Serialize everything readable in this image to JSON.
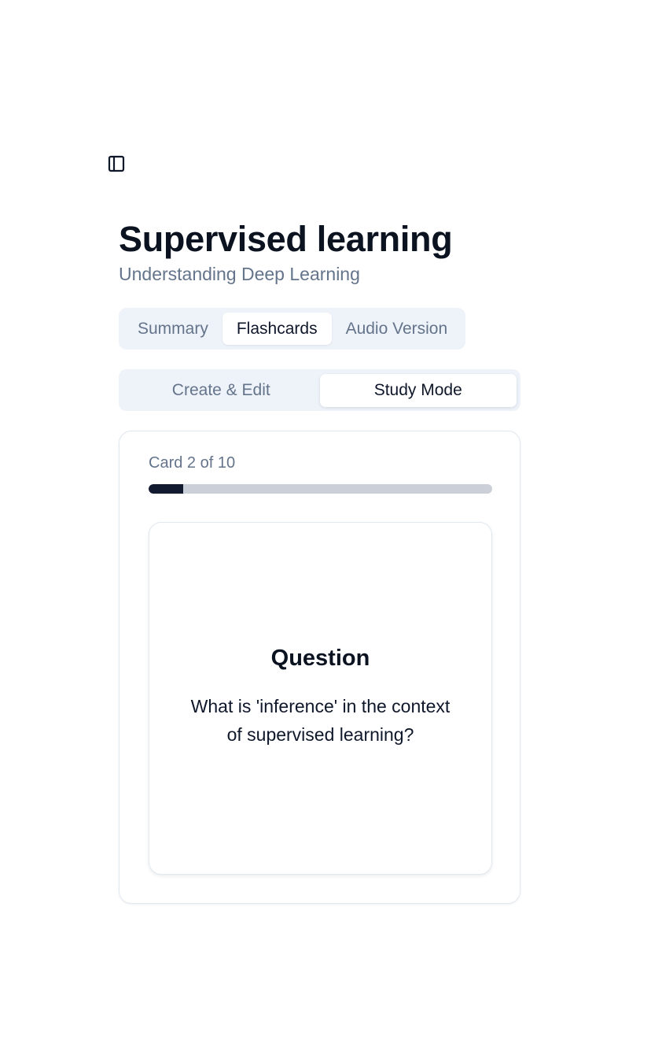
{
  "header": {
    "sidebar_toggle_icon": "sidebar-panel-icon",
    "title": "Supervised learning",
    "subtitle": "Understanding Deep Learning"
  },
  "tabs": [
    {
      "label": "Summary",
      "active": false
    },
    {
      "label": "Flashcards",
      "active": true
    },
    {
      "label": "Audio Version",
      "active": false
    }
  ],
  "mode": {
    "create_label": "Create & Edit",
    "study_label": "Study Mode",
    "active": "study"
  },
  "study": {
    "counter": "Card 2 of 10",
    "progress": 0.1,
    "card": {
      "heading": "Question",
      "text": "What is 'inference' in the context of supervised learning?"
    }
  },
  "colors": {
    "accent_dark": "#111a2e",
    "muted_text": "#64748b",
    "tab_background": "#eef2f9"
  }
}
